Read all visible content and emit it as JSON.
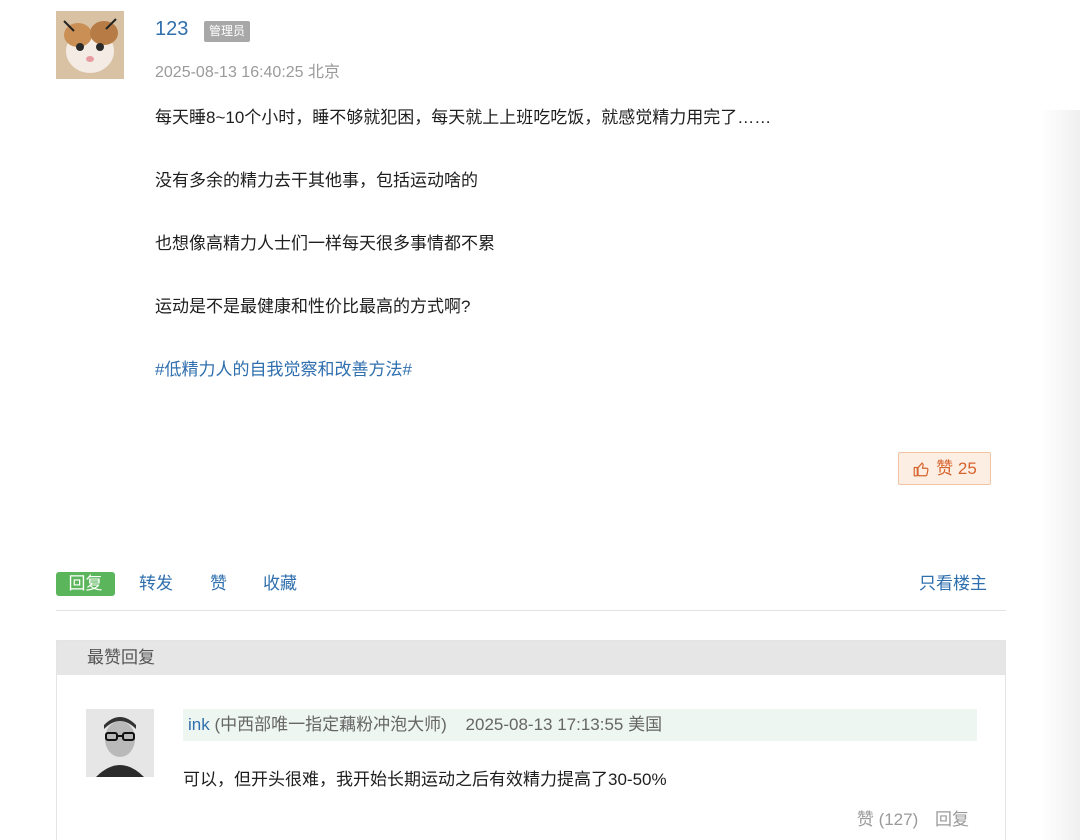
{
  "post": {
    "username": "123",
    "badge": "管理员",
    "meta": "2025-08-13 16:40:25 北京",
    "paragraphs": [
      "每天睡8~10个小时，睡不够就犯困，每天就上上班吃吃饭，就感觉精力用完了……",
      "没有多余的精力去干其他事，包括运动啥的",
      "也想像高精力人士们一样每天很多事情都不累",
      "运动是不是最健康和性价比最高的方式啊?"
    ],
    "hashtag": "#低精力人的自我觉察和改善方法#",
    "like_label": "赞 25"
  },
  "actions": {
    "reply": "回复",
    "repost": "转发",
    "like": "赞",
    "favorite": "收藏",
    "op_only": "只看楼主"
  },
  "best_replies": {
    "header": "最赞回复",
    "items": [
      {
        "user": "ink",
        "title": "(中西部唯一指定藕粉冲泡大师)",
        "time": "2025-08-13 17:13:55 美国",
        "text": "可以，但开头很难，我开始长期运动之后有效精力提高了30-50%",
        "like_label": "赞 (127)",
        "reply_label": "回复"
      }
    ]
  }
}
